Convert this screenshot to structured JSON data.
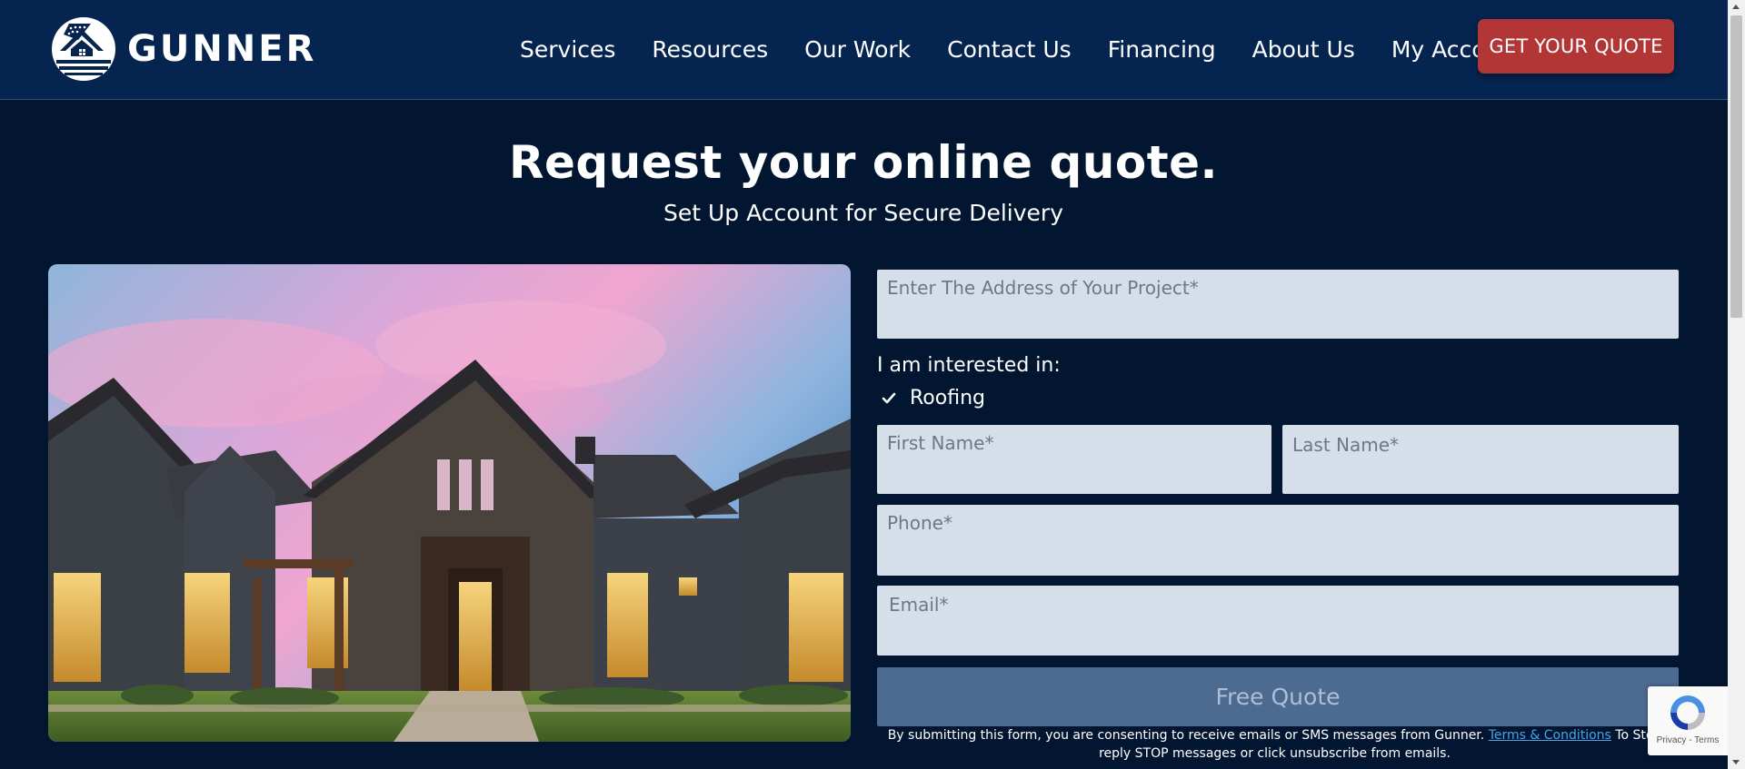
{
  "brand": {
    "name": "GUNNER",
    "logo_icon": "gunner-shield-house-icon"
  },
  "nav": {
    "items": [
      {
        "label": "Services"
      },
      {
        "label": "Resources"
      },
      {
        "label": "Our Work"
      },
      {
        "label": "Contact Us"
      },
      {
        "label": "Financing"
      },
      {
        "label": "About Us"
      },
      {
        "label": "My Account"
      }
    ],
    "cta_label": "GET YOUR QUOTE"
  },
  "hero": {
    "title": "Request your online quote.",
    "subtitle": "Set Up Account for Secure Delivery"
  },
  "form": {
    "address_placeholder": "Enter The Address of Your Project*",
    "interest_label": "I am interested in:",
    "interest_options": [
      {
        "label": "Roofing",
        "checked": true,
        "icon": "check-icon"
      }
    ],
    "first_name_placeholder": "First Name*",
    "last_name_placeholder": "Last Name*",
    "phone_placeholder": "Phone*",
    "email_placeholder": "Email*",
    "submit_label": "Free Quote"
  },
  "disclaimer": {
    "text_before": "By submitting this form, you are consenting to receive emails or SMS messages from Gunner. ",
    "link_text": "Terms & Conditions",
    "text_after": " To Stop reply STOP messages or click unsubscribe from emails."
  },
  "recaptcha": {
    "links": "Privacy - Terms"
  },
  "colors": {
    "background": "#021631",
    "header": "#05244f",
    "cta": "#b23636",
    "field": "#d6dfe9",
    "submit": "#4d6a91",
    "link": "#4aa3e8"
  }
}
